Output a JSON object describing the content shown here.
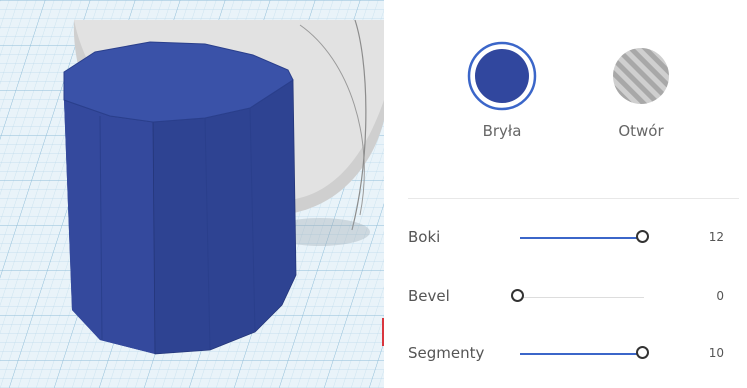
{
  "shape_type": {
    "solid_label": "Bryła",
    "hole_label": "Otwór",
    "solid_color": "#31479e",
    "selected": "solid"
  },
  "params": [
    {
      "label": "Boki",
      "value": "12",
      "level": 1.0
    },
    {
      "label": "Bevel",
      "value": "0",
      "level": 0.0
    },
    {
      "label": "Segmenty",
      "value": "10",
      "level": 1.0
    }
  ],
  "colors": {
    "accent": "#3b66c9",
    "shape": "#31479e",
    "grid": "#a7cde3"
  }
}
